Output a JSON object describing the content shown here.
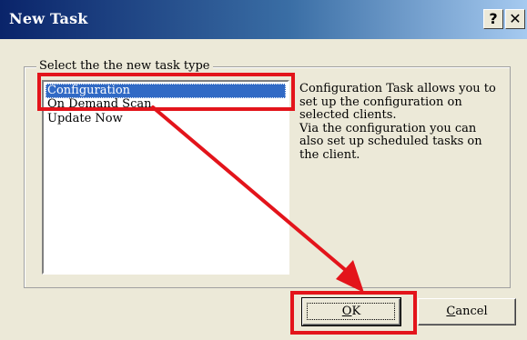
{
  "window": {
    "title": "New Task",
    "help_label": "?",
    "close_label": "✕"
  },
  "group": {
    "legend": "Select the the new task type"
  },
  "task_types": [
    {
      "label": "Configuration",
      "selected": true
    },
    {
      "label": "On Demand Scan",
      "selected": false
    },
    {
      "label": "Update Now",
      "selected": false
    }
  ],
  "description": {
    "line1": "Configuration Task allows you to set up the configuration on selected clients.",
    "line2": "Via the configuration you can also set up scheduled tasks on the client."
  },
  "buttons": {
    "ok_mnemonic": "O",
    "ok_rest": "K",
    "cancel_mnemonic": "C",
    "cancel_rest": "ancel"
  },
  "colors": {
    "annotation": "#e3141b",
    "selection": "#316ac5",
    "titlebar_start": "#0a246a"
  }
}
